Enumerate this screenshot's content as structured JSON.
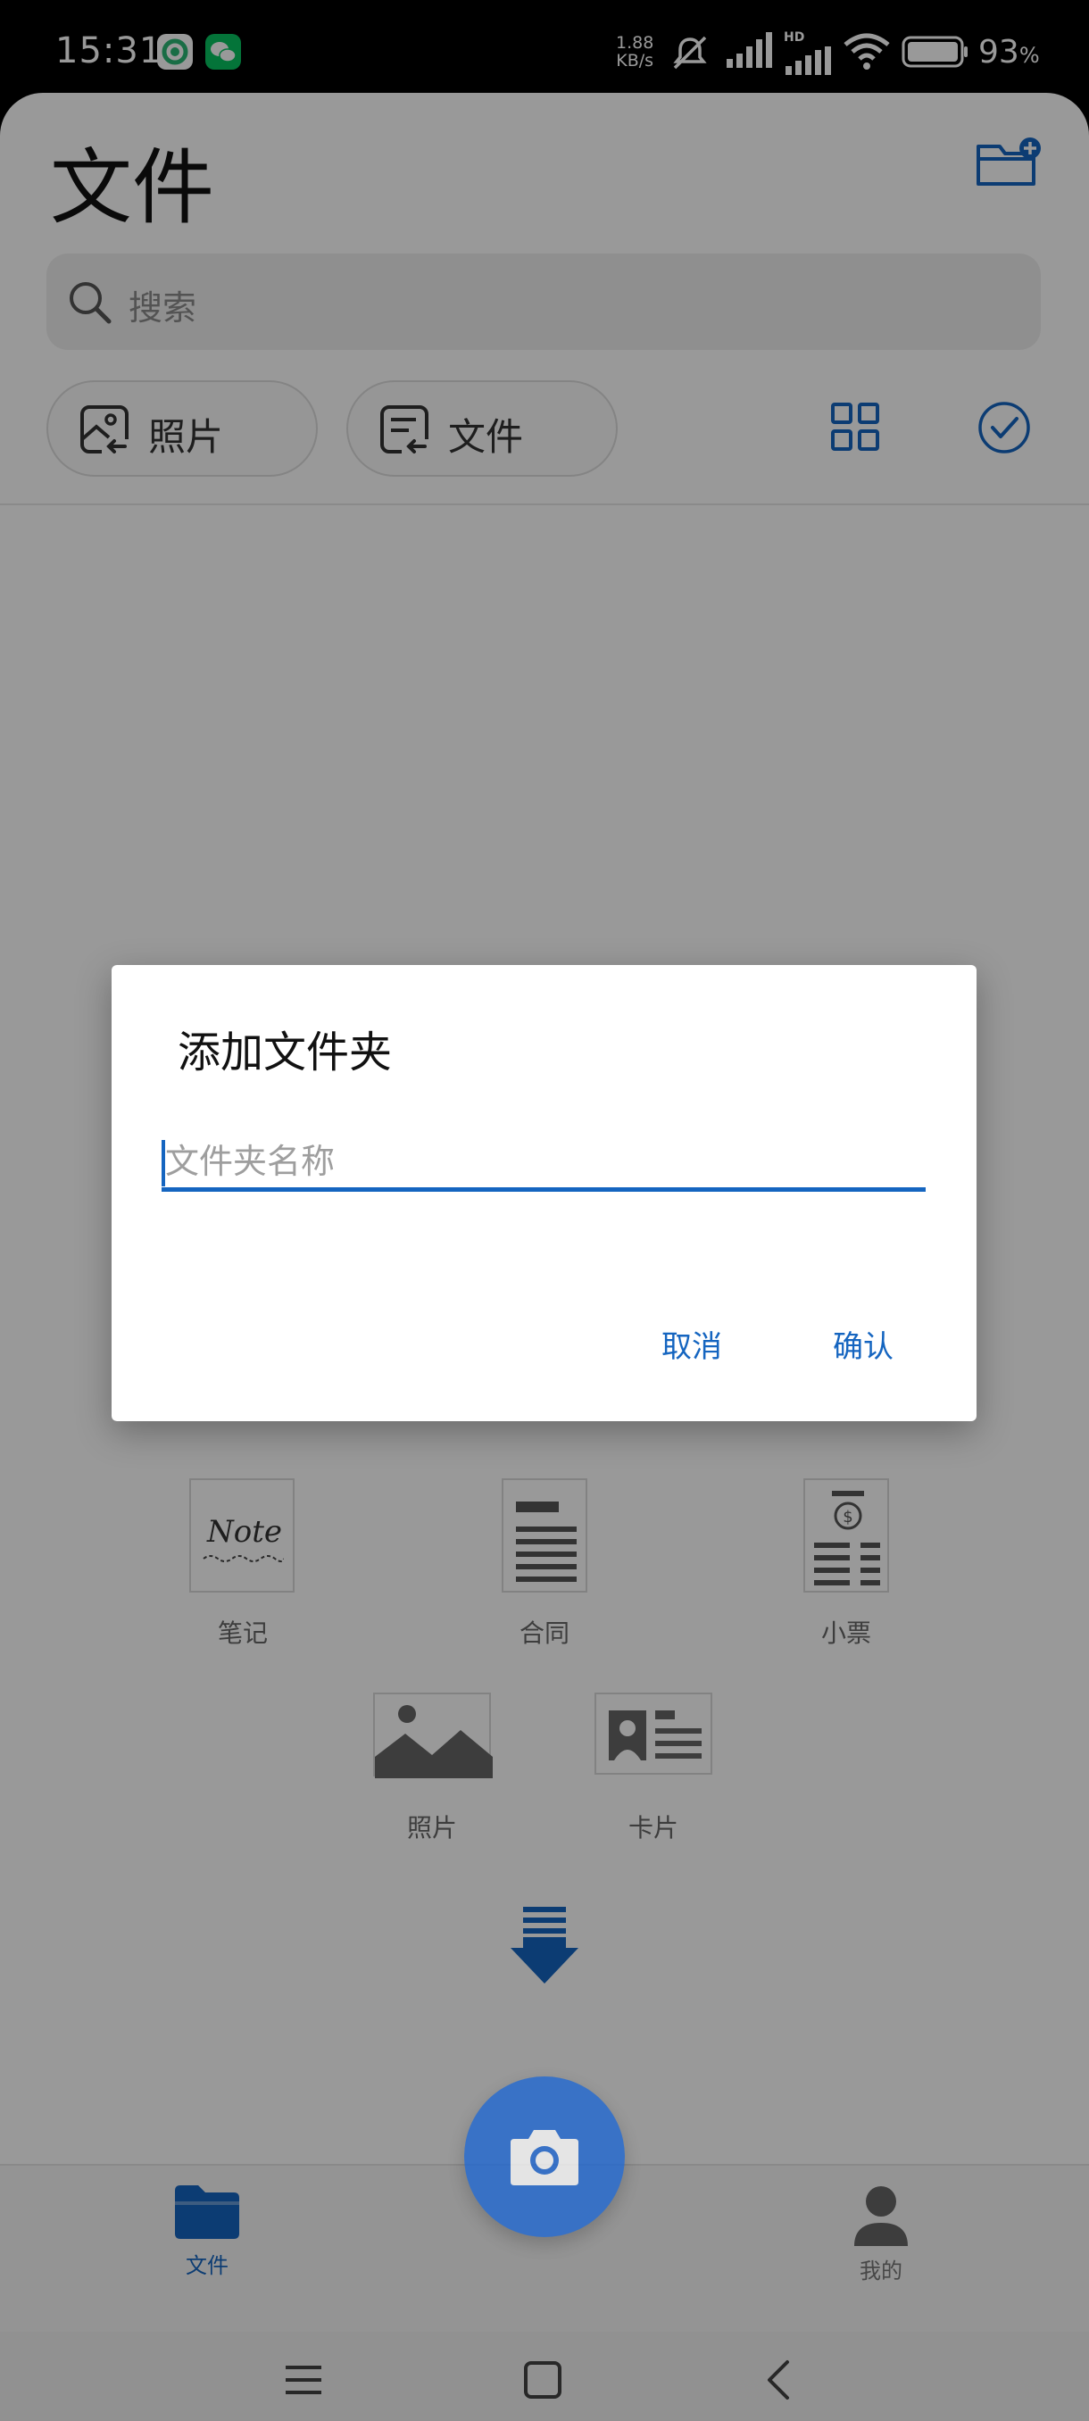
{
  "status_bar": {
    "time": "15:31",
    "net_speed_value": "1.88",
    "net_speed_unit": "KB/s",
    "network_label": "HD",
    "battery_percent": "93",
    "battery_unit": "%",
    "icons": [
      "app-notification-icon",
      "wechat-icon",
      "mute-icon",
      "signal-icon",
      "hd-signal-icon",
      "wifi-icon",
      "battery-icon"
    ]
  },
  "header": {
    "title": "文件",
    "add_folder_icon": "add-folder-icon"
  },
  "search": {
    "placeholder": "搜索"
  },
  "filters": {
    "photos_label": "照片",
    "files_label": "文件"
  },
  "templates": [
    {
      "label": "笔记",
      "thumb_text": "Note"
    },
    {
      "label": "合同"
    },
    {
      "label": "小票"
    },
    {
      "label": "照片"
    },
    {
      "label": "卡片"
    }
  ],
  "bottom_nav": {
    "files_label": "文件",
    "mine_label": "我的"
  },
  "dialog": {
    "title": "添加文件夹",
    "input_placeholder": "文件夹名称",
    "input_value": "",
    "cancel_label": "取消",
    "confirm_label": "确认"
  },
  "colors": {
    "accent": "#1565c0",
    "fab": "#1a66d6",
    "scrim": "rgba(0,0,0,0.4)"
  }
}
